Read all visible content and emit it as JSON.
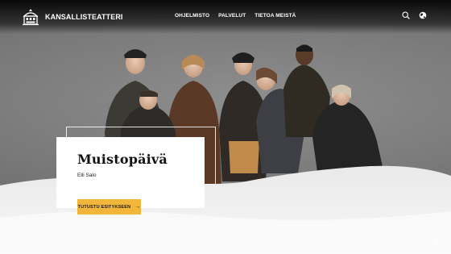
{
  "header": {
    "logo_text": "KANSALLISTEATTERI",
    "nav": [
      {
        "label": "OHJELMISTO"
      },
      {
        "label": "PALVELUT"
      },
      {
        "label": "TIETOA MEISTÄ"
      }
    ],
    "icons": [
      "search-icon",
      "globe-icon"
    ]
  },
  "hero": {
    "title": "Muistopäivä",
    "author": "Elli Salo",
    "cta_label": "TUTUSTU ESITYKSEEN",
    "cta_icon": "arrow-right-icon",
    "scroll_icon": "arrow-down-icon"
  },
  "colors": {
    "accent": "#f2b63a",
    "card": "#ffffff",
    "header": "#000000",
    "snow": "#f3f3f3"
  }
}
